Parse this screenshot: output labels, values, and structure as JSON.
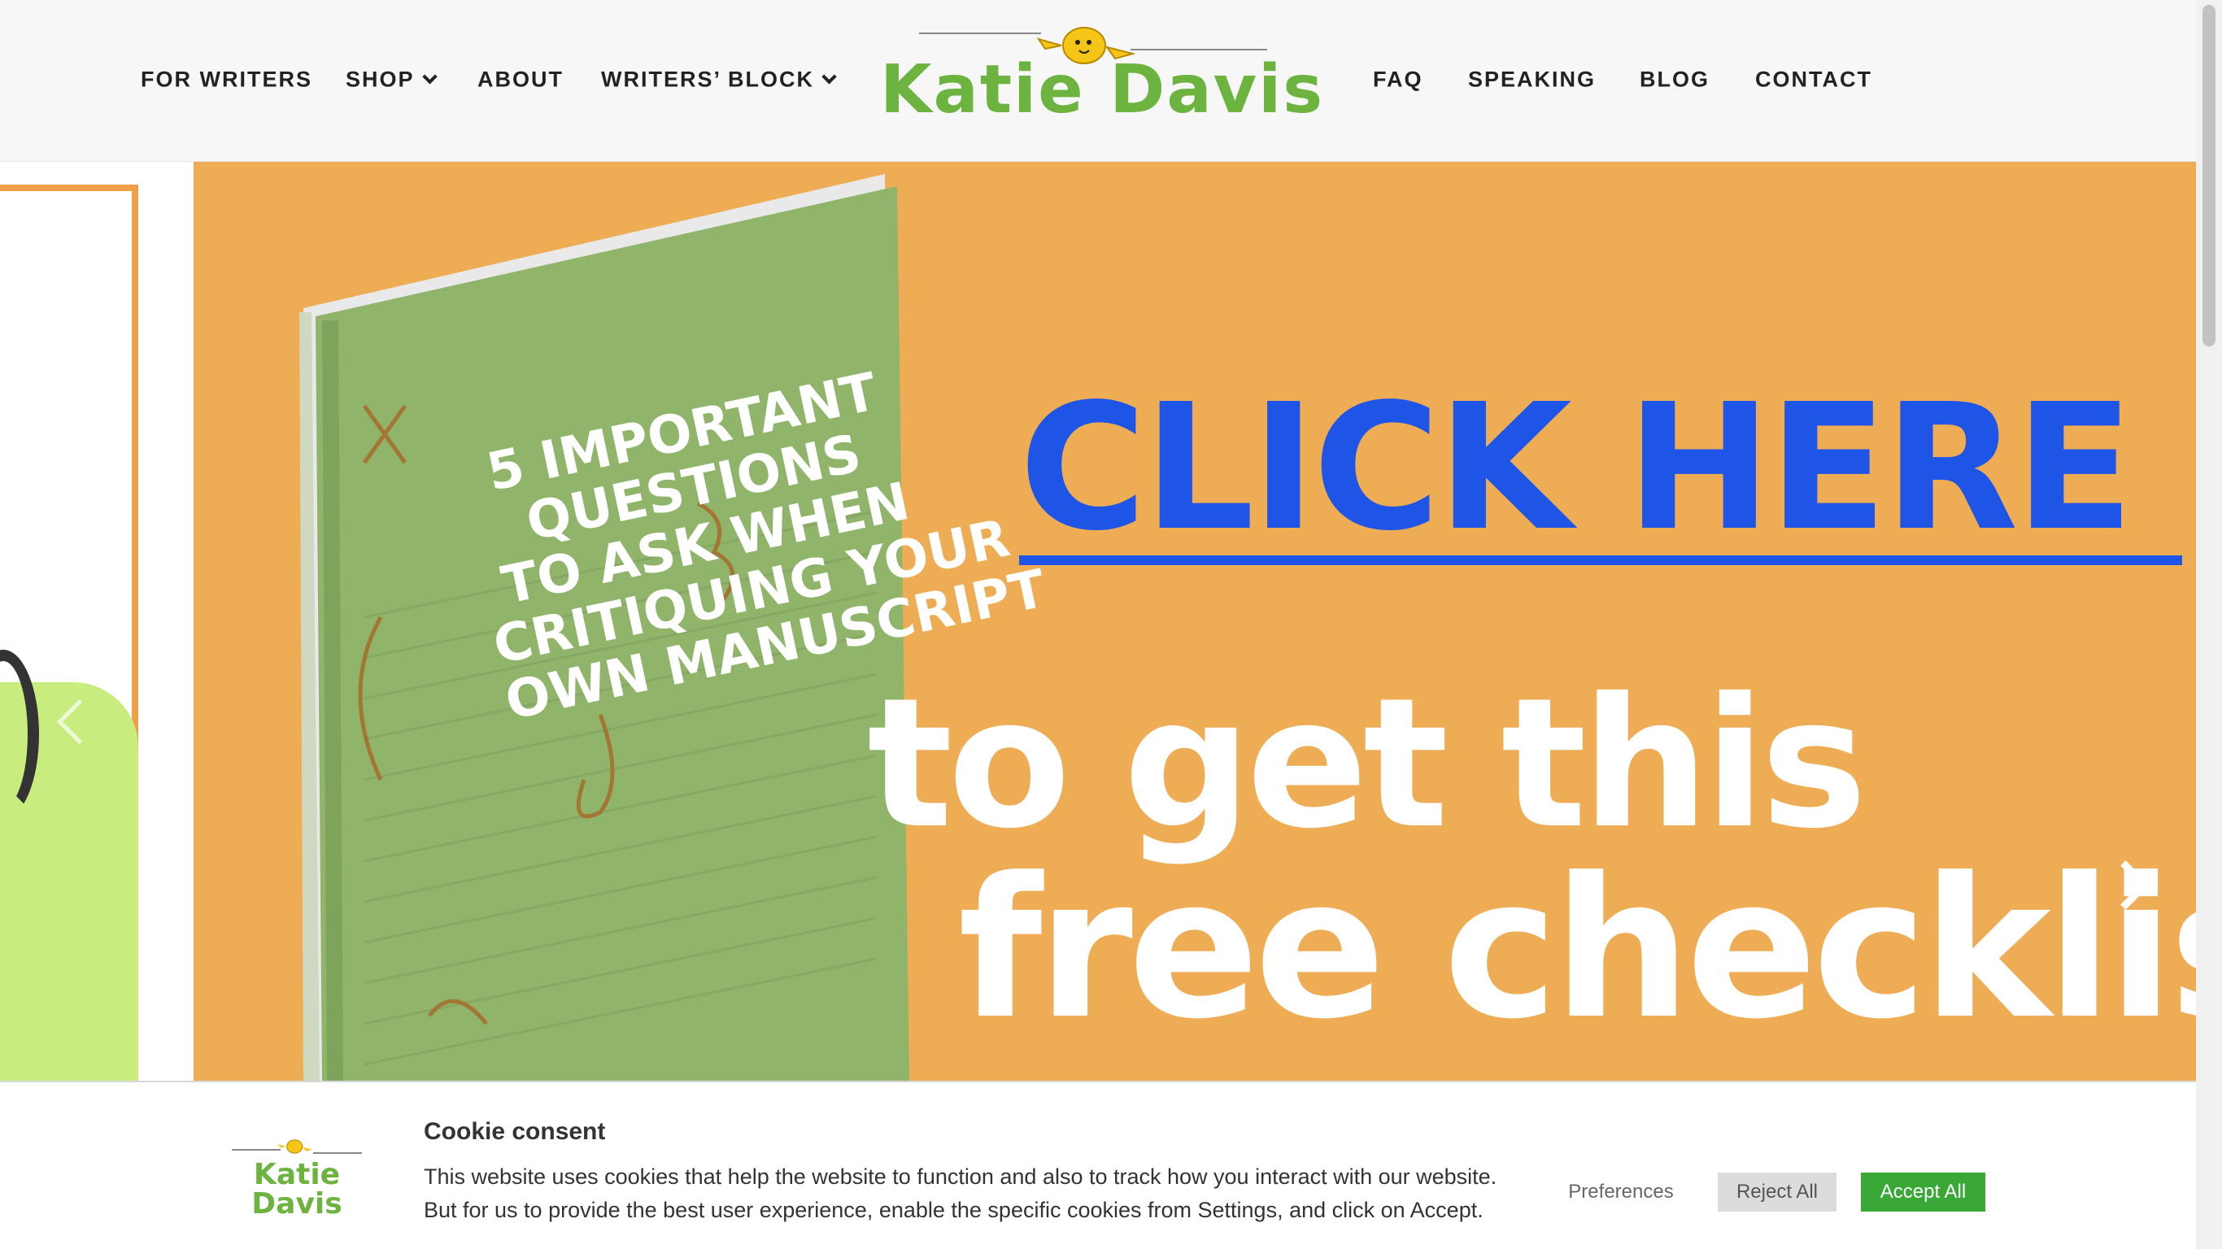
{
  "nav": {
    "left": [
      {
        "label": "FOR WRITERS",
        "dropdown": false
      },
      {
        "label": "SHOP",
        "dropdown": true
      },
      {
        "label": "ABOUT",
        "dropdown": false
      },
      {
        "label": "WRITERS’ BLOCK",
        "dropdown": true
      }
    ],
    "right": [
      {
        "label": "FAQ"
      },
      {
        "label": "SPEAKING"
      },
      {
        "label": "BLOG"
      },
      {
        "label": "CONTACT"
      }
    ]
  },
  "logo": {
    "text": "Katie Davis",
    "mascot": "yellow-chick-icon"
  },
  "hero": {
    "book_title_lines": [
      "5 IMPORTANT",
      "QUESTIONS",
      "TO ASK WHEN",
      "CRITIQUING YOUR",
      "OWN MANUSCRIPT"
    ],
    "cta_link": "CLICK HERE",
    "cta_line_1": "to get this",
    "cta_line_2": "free checklist"
  },
  "cookie": {
    "title": "Cookie consent",
    "description": "This website uses cookies that help the website to function and also to track how you interact with our website. But for us to provide the best user experience, enable the specific cookies from Settings, and click on Accept.",
    "logo_text": "Katie Davis",
    "buttons": {
      "preferences": "Preferences",
      "reject": "Reject All",
      "accept": "Accept All"
    }
  },
  "colors": {
    "brand_green": "#6db33f",
    "hero_orange": "#eeac54",
    "link_blue": "#1f55e6",
    "accept_green": "#3aa837",
    "book_green": "#8fb46a"
  }
}
